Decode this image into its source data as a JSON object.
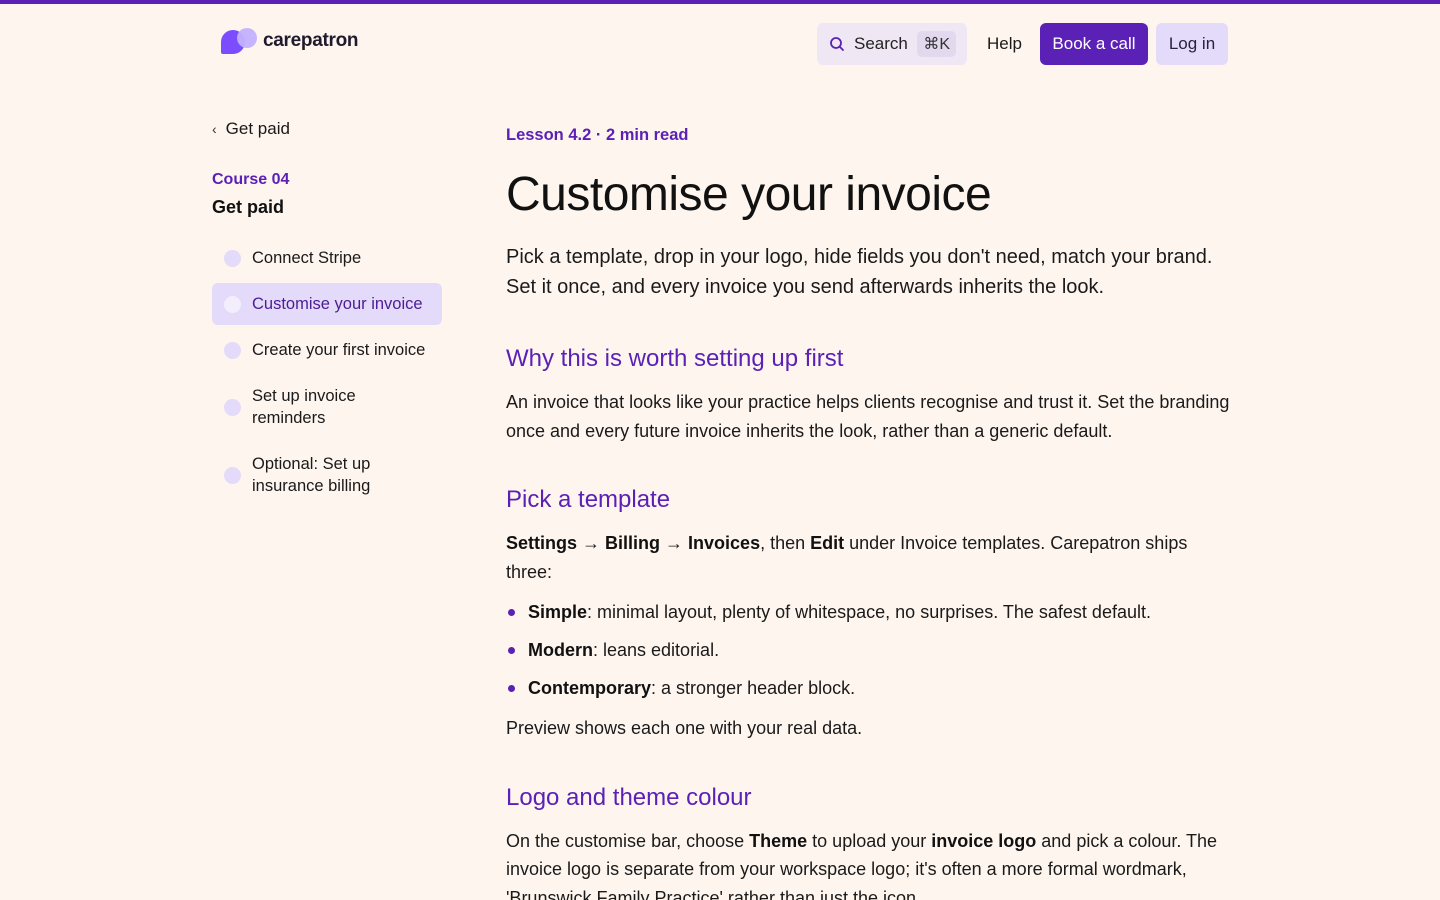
{
  "brand": {
    "name": "carepatron",
    "accent": "#5B21B6",
    "background": "#FDF5EE"
  },
  "header": {
    "search_label": "Search",
    "search_shortcut": "⌘K",
    "help": "Help",
    "book_call": "Book a call",
    "login": "Log in"
  },
  "sidebar": {
    "back_label": "Get paid",
    "course_kicker": "Course 04",
    "course_title": "Get paid",
    "lessons": [
      {
        "label": "Connect Stripe",
        "active": false
      },
      {
        "label": "Customise your invoice",
        "active": true
      },
      {
        "label": "Create your first invoice",
        "active": false
      },
      {
        "label": "Set up invoice reminders",
        "active": false
      },
      {
        "label": "Optional: Set up insurance billing",
        "active": false
      }
    ]
  },
  "article": {
    "kicker": "Lesson 4.2 · 2 min read",
    "title": "Customise your invoice",
    "lead": "Pick a template, drop in your logo, hide fields you don't need, match your brand. Set it once, and every invoice you send afterwards inherits the look.",
    "sections": {
      "why": {
        "heading": "Why this is worth setting up first",
        "body": "An invoice that looks like your practice helps clients recognise and trust it. Set the branding once and every future invoice inherits the look, rather than a generic default."
      },
      "template": {
        "heading": "Pick a template",
        "path_settings": "Settings",
        "arrow1": " → ",
        "path_billing": "Billing",
        "arrow2": " → ",
        "path_invoices": "Invoices",
        "then": ", then ",
        "edit": "Edit",
        "rest": " under Invoice templates. Carepatron ships three:",
        "bullets": [
          {
            "term": "Simple",
            "text": ": minimal layout, plenty of whitespace, no surprises. The safest default."
          },
          {
            "term": "Modern",
            "text": ": leans editorial."
          },
          {
            "term": "Contemporary",
            "text": ": a stronger header block."
          }
        ],
        "after": "Preview shows each one with your real data."
      },
      "logo": {
        "heading": "Logo and theme colour",
        "t1": "On the customise bar, choose ",
        "theme": "Theme",
        "t2": " to upload your ",
        "invoice_logo": "invoice logo",
        "t3": " and pick a colour. The invoice logo is separate from your workspace logo; it's often a more formal wordmark, 'Brunswick Family Practice' rather than just the icon."
      }
    }
  }
}
